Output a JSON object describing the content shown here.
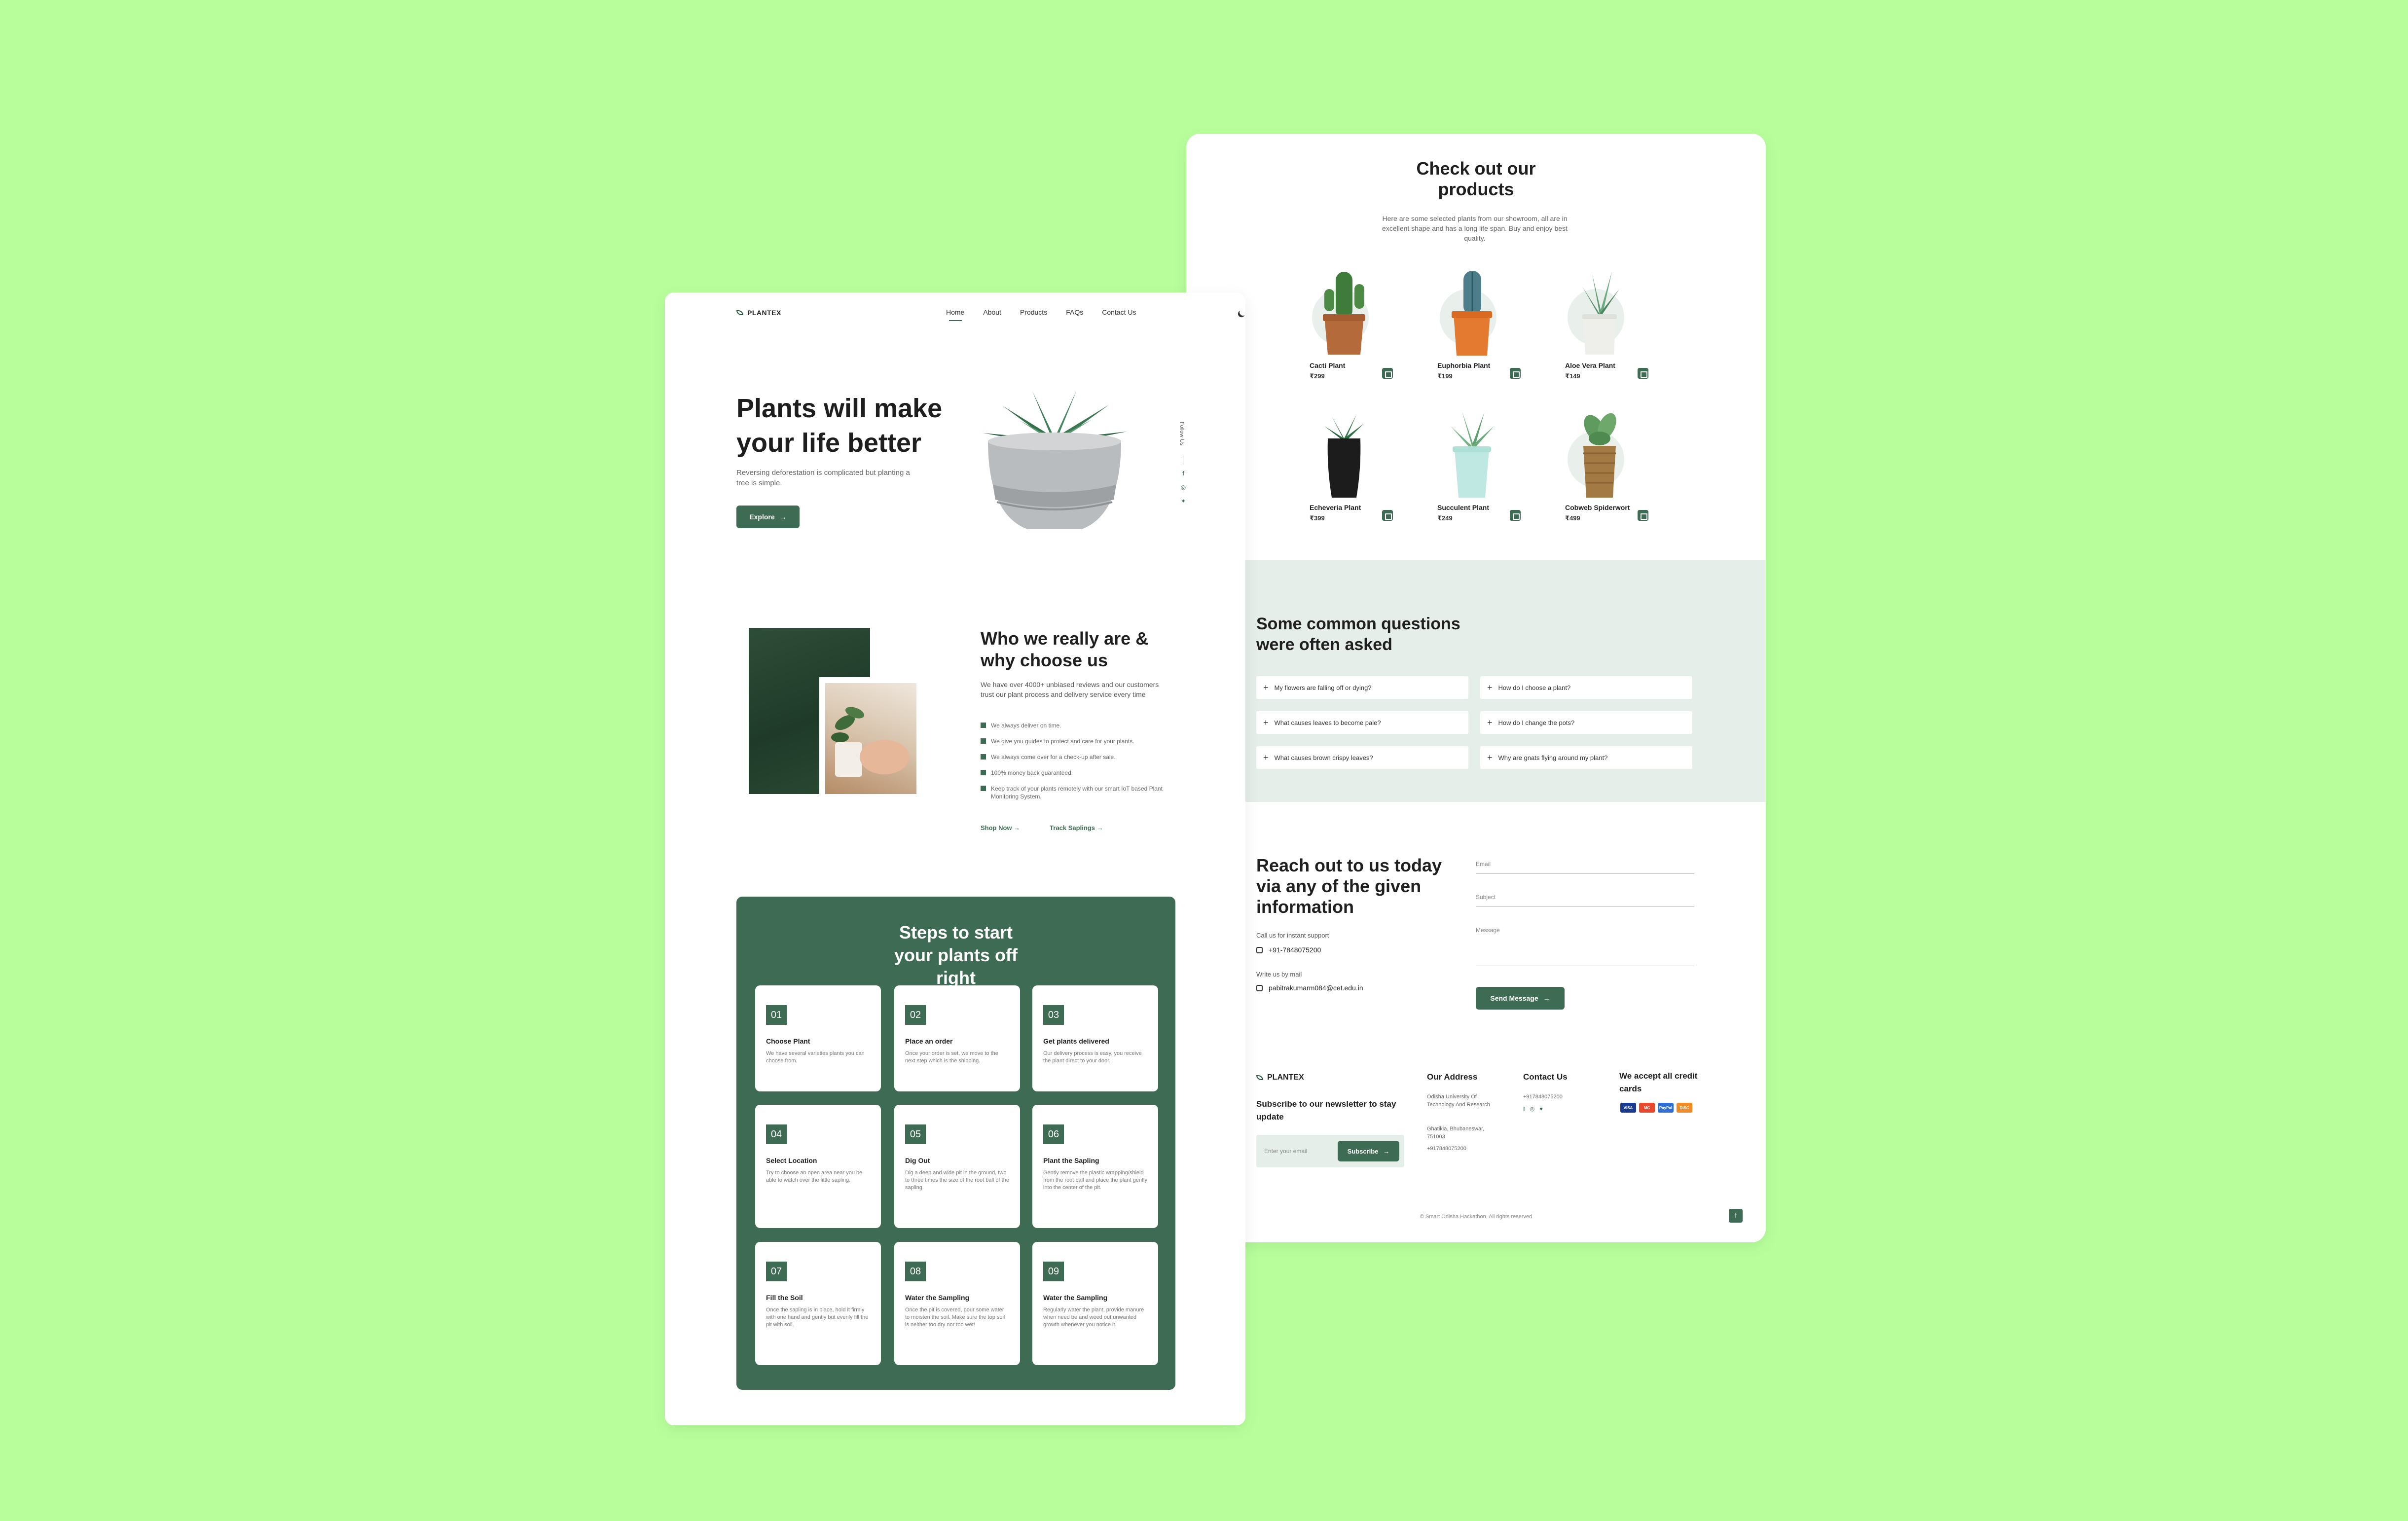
{
  "nav": {
    "brand": "PLANTEX",
    "links": [
      "Home",
      "About",
      "Products",
      "FAQs",
      "Contact Us"
    ]
  },
  "hero": {
    "title": "Plants will make your life better",
    "subtitle": "Reversing deforestation is complicated but planting a tree is simple.",
    "cta": "Explore",
    "follow": "Follow Us"
  },
  "about": {
    "title": "Who we really are & why choose us",
    "description": "We have over 4000+ unbiased reviews and our customers trust our plant process and delivery service every time",
    "points": [
      "We always deliver on time.",
      "We give you guides to protect and care for your plants.",
      "We always come over for a check-up after sale.",
      "100% money back guaranteed.",
      "Keep track of your plants remotely with our smart IoT based Plant Monitoring System."
    ],
    "link_shop": "Shop Now",
    "link_track": "Track Saplings"
  },
  "steps": {
    "title": "Steps to start your plants off right",
    "items": [
      {
        "num": "01",
        "title": "Choose Plant",
        "desc": "We have several varieties plants you can choose from."
      },
      {
        "num": "02",
        "title": "Place an order",
        "desc": "Once your order is set, we move to the next step which is the shipping."
      },
      {
        "num": "03",
        "title": "Get plants delivered",
        "desc": "Our delivery process is easy, you receive the plant direct to your door."
      },
      {
        "num": "04",
        "title": "Select Location",
        "desc": "Try to choose an open area near you be able to watch over the little sapling."
      },
      {
        "num": "05",
        "title": "Dig Out",
        "desc": "Dig a deep and wide pit in the ground, two to three times the size of the root ball of the sapling."
      },
      {
        "num": "06",
        "title": "Plant the Sapling",
        "desc": "Gently remove the plastic wrapping/shield from the root ball and place the plant gently into the center of the pit."
      },
      {
        "num": "07",
        "title": "Fill the Soil",
        "desc": "Once the sapling is in place, hold it firmly with one hand and gently but evenly fill the pit with soil."
      },
      {
        "num": "08",
        "title": "Water the Sampling",
        "desc": "Once the pit is covered, pour some water to moisten the soil. Make sure the top soil is neither too dry nor too wet!"
      },
      {
        "num": "09",
        "title": "Water the Sampling",
        "desc": "Regularly water the plant, provide manure when need be and weed out unwanted growth whenever you notice it."
      }
    ]
  },
  "products": {
    "title": "Check out our products",
    "subtitle": "Here are some selected plants from our showroom, all are in excellent shape and has a long life span. Buy and enjoy best quality.",
    "items": [
      {
        "name": "Cacti Plant",
        "price": "₹299"
      },
      {
        "name": "Euphorbia Plant",
        "price": "₹199"
      },
      {
        "name": "Aloe Vera Plant",
        "price": "₹149"
      },
      {
        "name": "Echeveria Plant",
        "price": "₹399"
      },
      {
        "name": "Succulent Plant",
        "price": "₹249"
      },
      {
        "name": "Cobweb Spiderwort",
        "price": "₹499"
      }
    ]
  },
  "faq": {
    "title": "Some common questions were often asked",
    "items": [
      "My flowers are falling off or dying?",
      "How do I choose a plant?",
      "What causes leaves to become pale?",
      "How do I change the pots?",
      "What causes brown crispy leaves?",
      "Why are gnats flying around my plant?"
    ]
  },
  "contact": {
    "title": "Reach out to us today via any of the given information",
    "support_label": "Call us for instant support",
    "phone": "+91-7848075200",
    "mail_label": "Write us by mail",
    "email": "pabitrakumarm084@cet.edu.in",
    "email_field": "Email",
    "subject_field": "Subject",
    "message_field": "Message",
    "send": "Send Message"
  },
  "footer": {
    "brand": "PLANTEX",
    "newsletter": "Subscribe to our newsletter to stay update",
    "email_placeholder": "Enter your email",
    "subscribe": "Subscribe",
    "address_title": "Our Address",
    "address_1": "Odisha University Of Technology And Research",
    "address_2": "Ghatikia, Bhubaneswar, 751003",
    "address_phone": "+917848075200",
    "contact_title": "Contact Us",
    "contact_phone": "+917848075200",
    "cards_title": "We accept all credit cards",
    "cards": [
      "VISA",
      "MC",
      "PayPal",
      "DISC"
    ],
    "copyright": "© Smart Odisha Hackathon. All rights reserved"
  }
}
